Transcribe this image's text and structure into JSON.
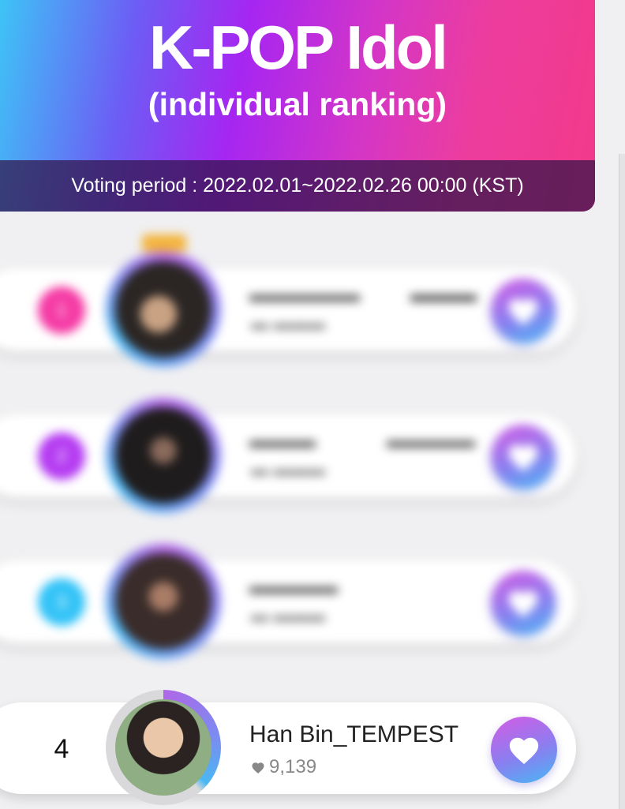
{
  "header": {
    "title": "K-POP Idol",
    "subtitle": "(individual ranking)",
    "voting_period": "Voting period : 2022.02.01~2022.02.26 00:00 (KST)"
  },
  "colors": {
    "rank_1": "#f53ba5",
    "rank_2": "#b53cf2",
    "rank_3": "#33c3f7",
    "heart_gradient_start": "#d45ce4",
    "heart_gradient_end": "#48b7f3"
  },
  "rankings": [
    {
      "rank": "1",
      "name": "",
      "votes": "",
      "blurred": true
    },
    {
      "rank": "2",
      "name": "",
      "votes": "",
      "blurred": true
    },
    {
      "rank": "3",
      "name": "",
      "votes": "",
      "blurred": true
    },
    {
      "rank": "4",
      "name": "Han Bin_TEMPEST",
      "votes": "9,139",
      "blurred": false
    }
  ],
  "icons": {
    "vote_button": "heart-icon",
    "vote_count": "heart-small-icon",
    "top_rank_badge": "crown-icon"
  }
}
